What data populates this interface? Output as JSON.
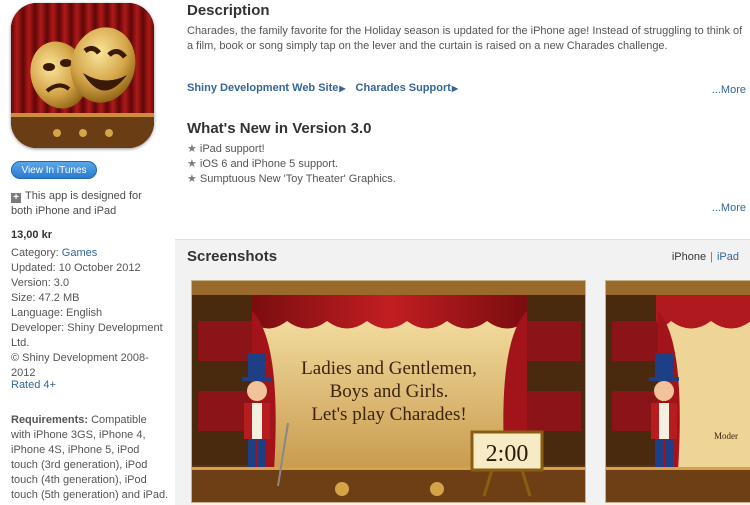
{
  "left": {
    "view_button": "View In iTunes",
    "designed_for": "This app is designed for both iPhone and iPad",
    "price": "13,00 kr",
    "category_label": "Category:",
    "category_value": "Games",
    "updated": "Updated: 10 October 2012",
    "version": "Version: 3.0",
    "size": "Size: 47.2 MB",
    "language": "Language: English",
    "developer": "Developer: Shiny Development Ltd.",
    "copyright": "© Shiny Development 2008-2012",
    "rated": "Rated 4+",
    "requirements_label": "Requirements:",
    "requirements_text": "Compatible with iPhone 3GS, iPhone 4, iPhone 4S, iPhone 5, iPod touch (3rd generation), iPod touch (4th generation), iPod touch (5th generation) and iPad. Requires"
  },
  "description": {
    "heading": "Description",
    "text": "Charades, the family favorite for the Holiday season is updated for the iPhone age! Instead of struggling to think of a film, book or song simply tap on the lever and the curtain is raised on a new Charades challenge.",
    "link1": "Shiny Development Web Site",
    "link2": "Charades Support",
    "more": "...More"
  },
  "whats_new": {
    "heading": "What's New in Version 3.0",
    "items": [
      "iPad support!",
      "iOS 6 and iPhone 5 support.",
      "Sumptuous New 'Toy Theater' Graphics."
    ],
    "more": "...More"
  },
  "screenshots": {
    "heading": "Screenshots",
    "tab_iphone": "iPhone",
    "separator": "|",
    "tab_ipad": "iPad",
    "shot1_line1": "Ladies and Gentlemen,",
    "shot1_line2": "Boys and Girls.",
    "shot1_line3": "Let's play Charades!",
    "shot1_timer": "2:00",
    "shot2_text": "Moder"
  },
  "colors": {
    "link": "#336699",
    "curtain": "#a3141a",
    "gold": "#d4a548"
  }
}
